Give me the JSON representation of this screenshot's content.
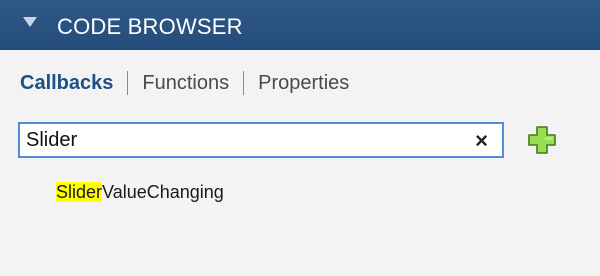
{
  "header": {
    "title": "CODE BROWSER",
    "collapse_icon": "triangle-down-icon"
  },
  "tabs": [
    {
      "label": "Callbacks",
      "active": true
    },
    {
      "label": "Functions",
      "active": false
    },
    {
      "label": "Properties",
      "active": false
    }
  ],
  "search": {
    "value": "Slider",
    "clear_icon": "close-icon",
    "clear_glyph": "×"
  },
  "add_button": {
    "icon": "plus-icon",
    "color": "#8ed14a"
  },
  "results": [
    {
      "match": "Slider",
      "rest": "ValueChanging"
    }
  ],
  "colors": {
    "header_bg": "#2a5381",
    "active_tab": "#1e4f86",
    "search_border": "#4d8fd6",
    "highlight": "#ffff00",
    "panel_bg": "#f3f3f3"
  }
}
